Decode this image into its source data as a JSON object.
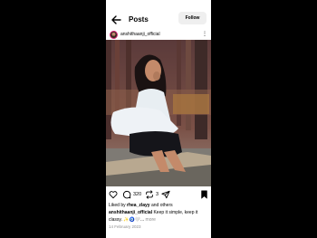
{
  "header": {
    "title": "Posts",
    "follow_label": "Follow",
    "back_icon": "back-arrow-icon"
  },
  "post": {
    "username": "anshithaanji_official",
    "more_label": "⋮",
    "actions": {
      "like_icon": "heart-icon",
      "comment_icon": "comment-icon",
      "comment_count": "320",
      "repost_icon": "repost-icon",
      "repost_count": "3",
      "share_icon": "send-icon",
      "save_icon": "bookmark-icon"
    },
    "liked_by": {
      "prefix": "Liked by ",
      "user": "rhea_zlayy",
      "suffix": " and others"
    },
    "caption": {
      "user": "anshithaanji_official",
      "text": " Keep it simple, keep it classy. ✨🧿🤍...",
      "more": " more"
    },
    "date": "14 February 2023"
  },
  "colors": {
    "background": "#000000",
    "screen": "#ffffff",
    "follow_bg": "#efefef",
    "muted_text": "#8e8e8e"
  }
}
